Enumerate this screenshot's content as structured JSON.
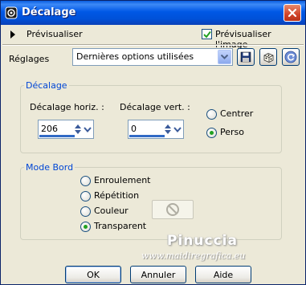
{
  "window": {
    "title": "Décalage",
    "close_icon": "close-x-icon"
  },
  "preview": {
    "toggle_label": "Prévisualiser",
    "checkbox_label": "Prévisualiser l'image",
    "checkbox_checked": true
  },
  "settings": {
    "label": "Réglages",
    "selected_value": "Dernières options utilisées",
    "icons": [
      "save-icon",
      "randomize-dice-icon",
      "reset-icon"
    ]
  },
  "offset_group": {
    "title": "Décalage",
    "horizontal_label": "Décalage horiz. :",
    "horizontal_value": "206",
    "vertical_label": "Décalage vert. :",
    "vertical_value": "0",
    "options": [
      {
        "label": "Centrer",
        "checked": false
      },
      {
        "label": "Perso",
        "checked": true
      }
    ]
  },
  "edge_mode_group": {
    "title": "Mode Bord",
    "options": [
      {
        "label": "Enroulement",
        "checked": false
      },
      {
        "label": "Répétition",
        "checked": false
      },
      {
        "label": "Couleur",
        "checked": false
      },
      {
        "label": "Transparent",
        "checked": true
      }
    ]
  },
  "watermark": {
    "name": "Pinuccia",
    "url": "www.maidiregrafica.eu"
  },
  "buttons": {
    "ok": "OK",
    "cancel": "Annuler",
    "help": "Aide"
  },
  "colors": {
    "title_bar": "#0058e6",
    "group_title": "#0046d5",
    "dialog_bg": "#ece9d8",
    "radio_checked": "#21a121"
  }
}
